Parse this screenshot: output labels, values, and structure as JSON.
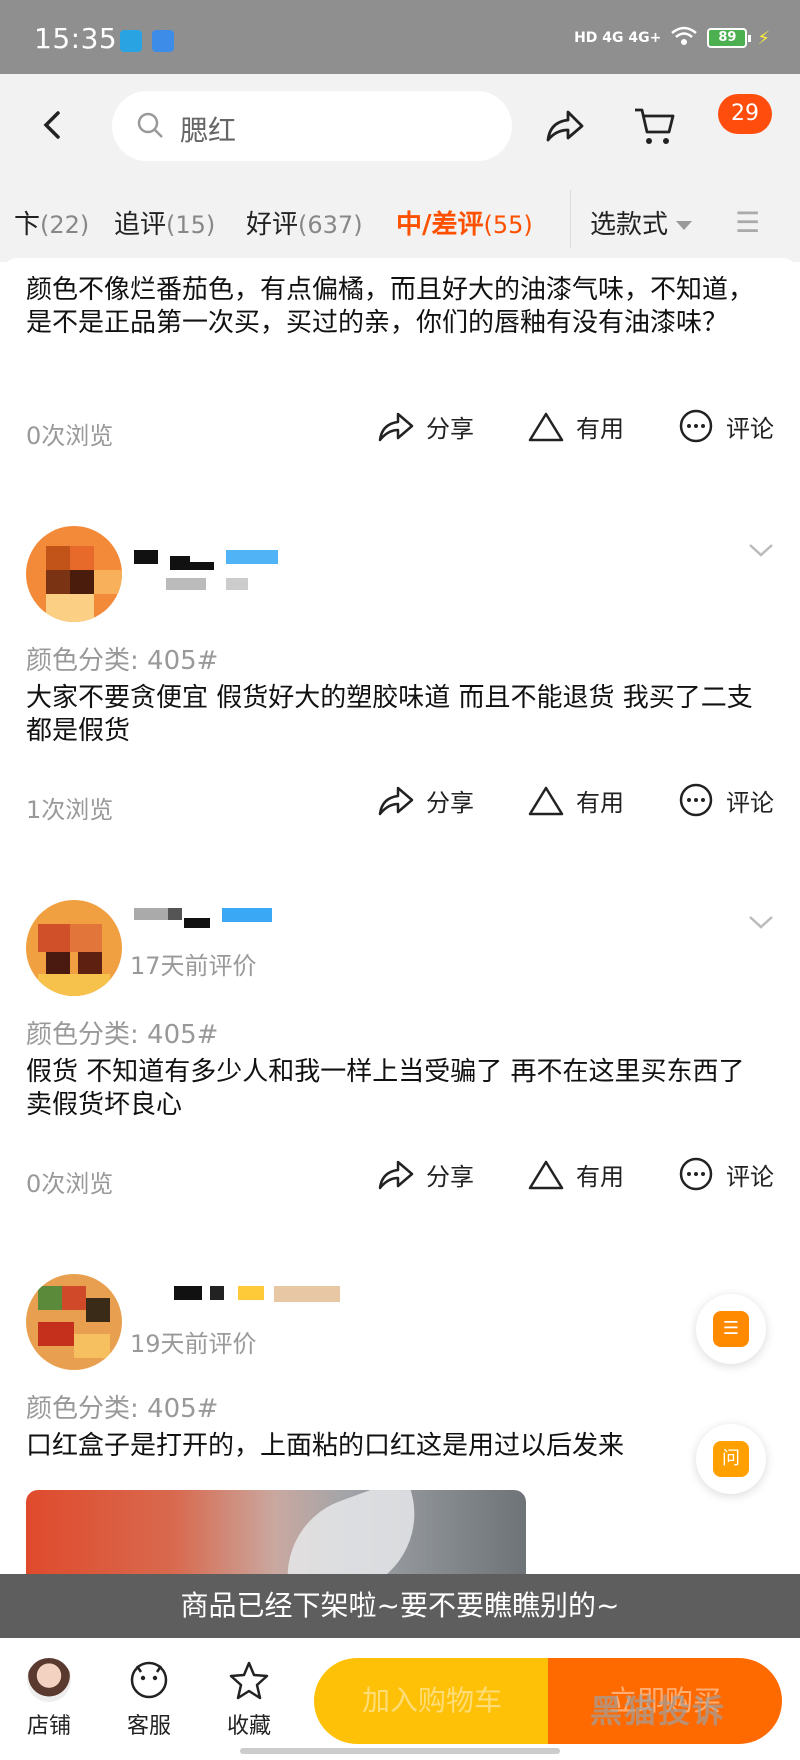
{
  "status_bar": {
    "time": "15:35",
    "network": "HD 4G 4G+",
    "battery": "89"
  },
  "header": {
    "search_text": "腮红",
    "cart_badge": "29"
  },
  "tabs": [
    {
      "label": "卞",
      "count": "(22)"
    },
    {
      "label": "追评",
      "count": "(15)"
    },
    {
      "label": "好评",
      "count": "(637)"
    },
    {
      "label": "中/差评",
      "count": "(55)"
    }
  ],
  "select_style_label": "选款式",
  "actions": {
    "share": "分享",
    "useful": "有用",
    "comment": "评论"
  },
  "reviews": [
    {
      "text": "颜色不像烂番茄色，有点偏橘，而且好大的油漆气味，不知道，是不是正品第一次买，买过的亲，你们的唇釉有没有油漆味？",
      "views": "0次浏览"
    },
    {
      "variant": "颜色分类: 405#",
      "text": "大家不要贪便宜 假货好大的塑胶味道 而且不能退货 我买了二支都是假货",
      "views": "1次浏览"
    },
    {
      "time": "17天前评价",
      "variant": "颜色分类: 405#",
      "text": "假货 不知道有多少人和我一样上当受骗了 再不在这里买东西了 卖假货坏良心",
      "views": "0次浏览"
    },
    {
      "time": "19天前评价",
      "variant": "颜色分类: 405#",
      "text": "口红盒子是打开的，上面粘的口红这是用过以后发来"
    }
  ],
  "float_buttons": {
    "ask": "问"
  },
  "banner": "商品已经下架啦~要不要瞧瞧别的~",
  "bottom_bar": {
    "shop": "店铺",
    "service": "客服",
    "favorite": "收藏",
    "add_cart": "加入购物车",
    "buy_now": "立即购买"
  },
  "watermark": "黑猫投诉"
}
